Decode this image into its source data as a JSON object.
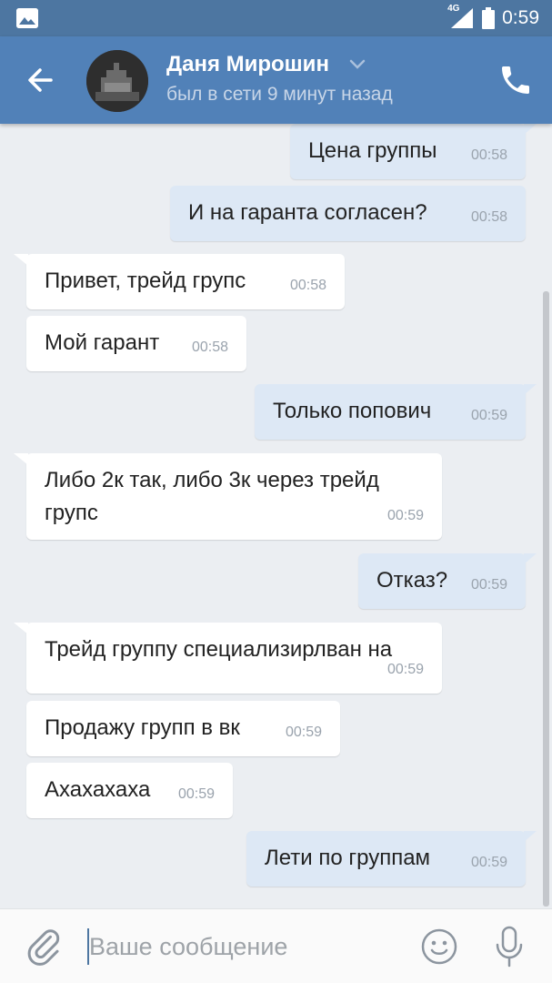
{
  "status_bar": {
    "network": "4G",
    "time": "0:59"
  },
  "header": {
    "contact_name": "Даня Мирошин",
    "last_seen": "был в сети 9 минут назад"
  },
  "messages": [
    {
      "dir": "out",
      "text": "Цена группы",
      "time": "00:58"
    },
    {
      "dir": "out",
      "text": "И на гаранта согласен?",
      "time": "00:58"
    },
    {
      "dir": "in",
      "text": "Привет, трейд групс",
      "time": "00:58"
    },
    {
      "dir": "in",
      "text": "Мой гарант",
      "time": "00:58"
    },
    {
      "dir": "out",
      "text": "Только попович",
      "time": "00:59"
    },
    {
      "dir": "in",
      "text": "Либо 2к так, либо 3к через трейд групс",
      "time": "00:59"
    },
    {
      "dir": "out",
      "text": "Отказ?",
      "time": "00:59"
    },
    {
      "dir": "in",
      "text": "Трейд группу специализирлван на",
      "time": "00:59"
    },
    {
      "dir": "in",
      "text": "Продажу групп в вк",
      "time": "00:59"
    },
    {
      "dir": "in",
      "text": "Ахахахаха",
      "time": "00:59"
    },
    {
      "dir": "out",
      "text": "Лети по группам",
      "time": "00:59"
    }
  ],
  "input": {
    "placeholder": "Ваше сообщение",
    "value": ""
  },
  "colors": {
    "header": "#5181b8",
    "status_bar": "#4d76a1",
    "chat_background": "#ebeef2",
    "outgoing_bubble": "#dde8f5",
    "incoming_bubble": "#ffffff"
  },
  "icons": [
    "gallery-icon",
    "signal-icon",
    "battery-icon",
    "back-arrow-icon",
    "chevron-down-icon",
    "phone-icon",
    "paperclip-icon",
    "smiley-icon",
    "microphone-icon"
  ]
}
